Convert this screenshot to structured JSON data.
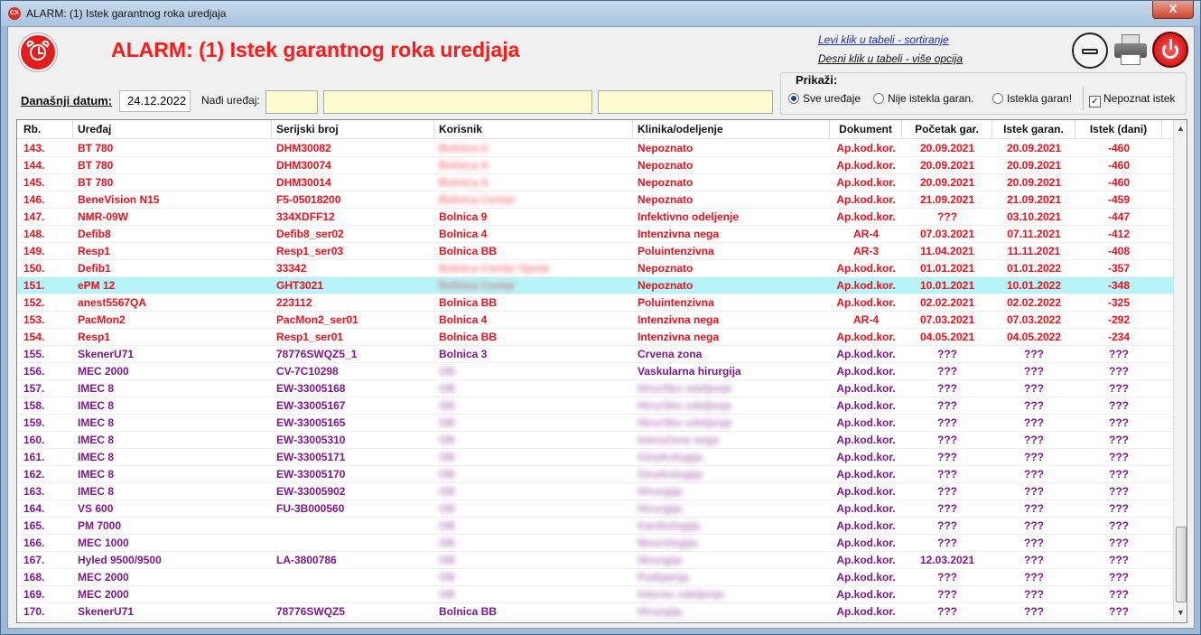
{
  "window": {
    "title": "ALARM: (1) Istek garantnog roka uredjaja",
    "icon_text": "CX",
    "close_label": "X"
  },
  "header": {
    "title": "ALARM: (1) Istek garantnog roka uredjaja",
    "hint_left": "Levi klik u tabeli - sortiranje",
    "hint_right": "Desni klik u tabeli - više opcija"
  },
  "filters": {
    "date_label": "Današnji datum:",
    "date_value": "24.12.2022",
    "find_label": "Nađi uređaj:",
    "find_values": [
      "",
      "",
      ""
    ],
    "show_label": "Prikaži:",
    "radios": [
      {
        "label": "Sve uređaje",
        "checked": true
      },
      {
        "label": "Nije istekla garan.",
        "checked": false
      },
      {
        "label": "Istekla garan!",
        "checked": false
      }
    ],
    "checkbox": {
      "label": "Nepoznat istek",
      "checked": true,
      "mark": "✓"
    }
  },
  "table": {
    "columns": [
      "Rb.",
      "Uređaj",
      "Serijski broj",
      "Korisnik",
      "Klinika/odeljenje",
      "Dokument",
      "Početak gar.",
      "Istek garan.",
      "Istek (dani)"
    ],
    "rows": [
      {
        "rb": "143.",
        "device": "BT 780",
        "serial": "DHM30082",
        "user": "Bolnica A",
        "clinic": "Nepoznato",
        "doc": "Ap.kod.kor.",
        "start": "20.09.2021",
        "end": "20.09.2021",
        "days": "-460",
        "color": "red",
        "blur_user": true,
        "blur_clinic": false
      },
      {
        "rb": "144.",
        "device": "BT 780",
        "serial": "DHM30074",
        "user": "Bolnica A",
        "clinic": "Nepoznato",
        "doc": "Ap.kod.kor.",
        "start": "20.09.2021",
        "end": "20.09.2021",
        "days": "-460",
        "color": "red",
        "blur_user": true,
        "blur_clinic": false
      },
      {
        "rb": "145.",
        "device": "BT 780",
        "serial": "DHM30014",
        "user": "Bolnica A",
        "clinic": "Nepoznato",
        "doc": "Ap.kod.kor.",
        "start": "20.09.2021",
        "end": "20.09.2021",
        "days": "-460",
        "color": "red",
        "blur_user": true,
        "blur_clinic": false
      },
      {
        "rb": "146.",
        "device": "BeneVision N15",
        "serial": "F5-05018200",
        "user": "Bolnica Centar",
        "clinic": "Nepoznato",
        "doc": "Ap.kod.kor.",
        "start": "21.09.2021",
        "end": "21.09.2021",
        "days": "-459",
        "color": "red",
        "blur_user": true,
        "blur_clinic": false
      },
      {
        "rb": "147.",
        "device": "NMR-09W",
        "serial": "334XDFF12",
        "user": "Bolnica 9",
        "clinic": "Infektivno odeljenje",
        "doc": "Ap.kod.kor.",
        "start": "???",
        "end": "03.10.2021",
        "days": "-447",
        "color": "red",
        "blur_user": false,
        "blur_clinic": false
      },
      {
        "rb": "148.",
        "device": "Defib8",
        "serial": "Defib8_ser02",
        "user": "Bolnica 4",
        "clinic": "Intenzivna nega",
        "doc": "AR-4",
        "start": "07.03.2021",
        "end": "07.11.2021",
        "days": "-412",
        "color": "red",
        "blur_user": false,
        "blur_clinic": false
      },
      {
        "rb": "149.",
        "device": "Resp1",
        "serial": "Resp1_ser03",
        "user": "Bolnica BB",
        "clinic": "Poluintenzivna",
        "doc": "AR-3",
        "start": "11.04.2021",
        "end": "11.11.2021",
        "days": "-408",
        "color": "red",
        "blur_user": false,
        "blur_clinic": false
      },
      {
        "rb": "150.",
        "device": "Defib1",
        "serial": "33342",
        "user": "Bolnica Centar Opsta",
        "clinic": "Nepoznato",
        "doc": "Ap.kod.kor.",
        "start": "01.01.2021",
        "end": "01.01.2022",
        "days": "-357",
        "color": "red",
        "blur_user": true,
        "blur_clinic": false
      },
      {
        "rb": "151.",
        "device": "ePM 12",
        "serial": "GHT3021",
        "user": "Bolnica Centar",
        "clinic": "Nepoznato",
        "doc": "Ap.kod.kor.",
        "start": "10.01.2021",
        "end": "10.01.2022",
        "days": "-348",
        "color": "sel",
        "blur_user": true,
        "blur_clinic": false
      },
      {
        "rb": "152.",
        "device": "anest5567QA",
        "serial": "223112",
        "user": "Bolnica BB",
        "clinic": "Poluintenzivna",
        "doc": "Ap.kod.kor.",
        "start": "02.02.2021",
        "end": "02.02.2022",
        "days": "-325",
        "color": "red",
        "blur_user": false,
        "blur_clinic": false
      },
      {
        "rb": "153.",
        "device": "PacMon2",
        "serial": "PacMon2_ser01",
        "user": "Bolnica 4",
        "clinic": "Intenzivna nega",
        "doc": "AR-4",
        "start": "07.03.2021",
        "end": "07.03.2022",
        "days": "-292",
        "color": "red",
        "blur_user": false,
        "blur_clinic": false
      },
      {
        "rb": "154.",
        "device": "Resp1",
        "serial": "Resp1_ser01",
        "user": "Bolnica BB",
        "clinic": "Intenzivna nega",
        "doc": "Ap.kod.kor.",
        "start": "04.05.2021",
        "end": "04.05.2022",
        "days": "-234",
        "color": "red",
        "blur_user": false,
        "blur_clinic": false
      },
      {
        "rb": "155.",
        "device": "SkenerU71",
        "serial": "78776SWQZ5_1",
        "user": "Bolnica 3",
        "clinic": "Crvena zona",
        "doc": "Ap.kod.kor.",
        "start": "???",
        "end": "???",
        "days": "???",
        "color": "pur",
        "blur_user": false,
        "blur_clinic": false
      },
      {
        "rb": "156.",
        "device": "MEC 2000",
        "serial": "CV-7C10298",
        "user": "OB",
        "clinic": "Vaskularna hirurgija",
        "doc": "Ap.kod.kor.",
        "start": "???",
        "end": "???",
        "days": "???",
        "color": "pur",
        "blur_user": true,
        "blur_clinic": false
      },
      {
        "rb": "157.",
        "device": "IMEC 8",
        "serial": "EW-33005168",
        "user": "OB",
        "clinic": "Hirurško odeljenje",
        "doc": "Ap.kod.kor.",
        "start": "???",
        "end": "???",
        "days": "???",
        "color": "pur",
        "blur_user": true,
        "blur_clinic": true
      },
      {
        "rb": "158.",
        "device": "IMEC 8",
        "serial": "EW-33005167",
        "user": "OB",
        "clinic": "Hirurško odeljenje",
        "doc": "Ap.kod.kor.",
        "start": "???",
        "end": "???",
        "days": "???",
        "color": "pur",
        "blur_user": true,
        "blur_clinic": true
      },
      {
        "rb": "159.",
        "device": "IMEC 8",
        "serial": "EW-33005165",
        "user": "OB",
        "clinic": "Hirurško odeljenje",
        "doc": "Ap.kod.kor.",
        "start": "???",
        "end": "???",
        "days": "???",
        "color": "pur",
        "blur_user": true,
        "blur_clinic": true
      },
      {
        "rb": "160.",
        "device": "IMEC 8",
        "serial": "EW-33005310",
        "user": "OB",
        "clinic": "Intenzivna nega",
        "doc": "Ap.kod.kor.",
        "start": "???",
        "end": "???",
        "days": "???",
        "color": "pur",
        "blur_user": true,
        "blur_clinic": true
      },
      {
        "rb": "161.",
        "device": "IMEC 8",
        "serial": "EW-33005171",
        "user": "OB",
        "clinic": "Ginekologija",
        "doc": "Ap.kod.kor.",
        "start": "???",
        "end": "???",
        "days": "???",
        "color": "pur",
        "blur_user": true,
        "blur_clinic": true
      },
      {
        "rb": "162.",
        "device": "IMEC 8",
        "serial": "EW-33005170",
        "user": "OB",
        "clinic": "Ginekologija",
        "doc": "Ap.kod.kor.",
        "start": "???",
        "end": "???",
        "days": "???",
        "color": "pur",
        "blur_user": true,
        "blur_clinic": true
      },
      {
        "rb": "163.",
        "device": "IMEC 8",
        "serial": "EW-33005902",
        "user": "OB",
        "clinic": "Hirurgija",
        "doc": "Ap.kod.kor.",
        "start": "???",
        "end": "???",
        "days": "???",
        "color": "pur",
        "blur_user": true,
        "blur_clinic": true
      },
      {
        "rb": "164.",
        "device": "VS 600",
        "serial": "FU-3B000560",
        "user": "OB",
        "clinic": "Hirurgija",
        "doc": "Ap.kod.kor.",
        "start": "???",
        "end": "???",
        "days": "???",
        "color": "pur",
        "blur_user": true,
        "blur_clinic": true
      },
      {
        "rb": "165.",
        "device": "PM 7000",
        "serial": "",
        "user": "OB",
        "clinic": "Kardiologija",
        "doc": "Ap.kod.kor.",
        "start": "???",
        "end": "???",
        "days": "???",
        "color": "pur",
        "blur_user": true,
        "blur_clinic": true
      },
      {
        "rb": "166.",
        "device": "MEC 1000",
        "serial": "",
        "user": "OB",
        "clinic": "Neurologija",
        "doc": "Ap.kod.kor.",
        "start": "???",
        "end": "???",
        "days": "???",
        "color": "pur",
        "blur_user": true,
        "blur_clinic": true
      },
      {
        "rb": "167.",
        "device": "Hyled 9500/9500",
        "serial": "LA-3800786",
        "user": "OB",
        "clinic": "Hirurgija",
        "doc": "Ap.kod.kor.",
        "start": "12.03.2021",
        "end": "???",
        "days": "???",
        "color": "pur",
        "blur_user": true,
        "blur_clinic": true
      },
      {
        "rb": "168.",
        "device": "MEC 2000",
        "serial": "",
        "user": "OB",
        "clinic": "Pedijatrija",
        "doc": "Ap.kod.kor.",
        "start": "???",
        "end": "???",
        "days": "???",
        "color": "pur",
        "blur_user": true,
        "blur_clinic": true
      },
      {
        "rb": "169.",
        "device": "MEC 2000",
        "serial": "",
        "user": "OB",
        "clinic": "Interno odeljenje",
        "doc": "Ap.kod.kor.",
        "start": "???",
        "end": "???",
        "days": "???",
        "color": "pur",
        "blur_user": true,
        "blur_clinic": true
      },
      {
        "rb": "170.",
        "device": "SkenerU71",
        "serial": "78776SWQZ5",
        "user": "Bolnica BB",
        "clinic": "Hirurgija",
        "doc": "Ap.kod.kor.",
        "start": "???",
        "end": "???",
        "days": "???",
        "color": "pur",
        "blur_user": false,
        "blur_clinic": true
      }
    ]
  },
  "scrollbar": {
    "up": "▲",
    "down": "▼"
  },
  "colors": {
    "alarm_red": "#e6121f",
    "unknown_purple": "#7a1a86",
    "selection": "#b6f4f7",
    "input_yellow": "#fdfcd0"
  }
}
